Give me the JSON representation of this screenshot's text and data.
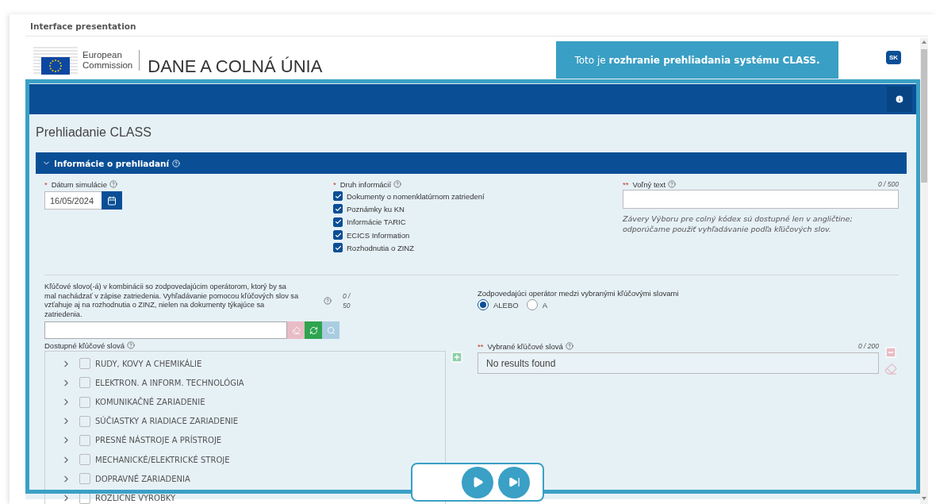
{
  "presentation": {
    "title": "Interface presentation"
  },
  "branding": {
    "org_line1": "European",
    "org_line2": "Commission",
    "site_title": "DANE A COLNÁ ÚNIA"
  },
  "notice": "Toto je **rozhranie prehliadania systému CLASS.**",
  "language": "SK",
  "page_title": "Prehliadanie CLASS",
  "section": {
    "title": "Informácie o prehliadaní",
    "expanded": true
  },
  "simulation_date": {
    "required_mark": "*",
    "label": "Dátum simulácie",
    "value": "16/05/2024"
  },
  "info_types": {
    "required_mark": "*",
    "label": "Druh informácií",
    "options": [
      {
        "label": "Dokumenty o nomenklatúrnom zatriedení",
        "checked": true
      },
      {
        "label": "Poznámky ku KN",
        "checked": true
      },
      {
        "label": "Informácie TARIC",
        "checked": true
      },
      {
        "label": "ECICS Information",
        "checked": true
      },
      {
        "label": "Rozhodnutia o ZINZ",
        "checked": true
      }
    ]
  },
  "free_text": {
    "required_mark": "**",
    "label": "Voľný text",
    "counter": "0 / 500",
    "note": "Závery Výboru pre colný kódex sú dostupné len v angličtine; odporúčame použiť vyhľadávanie podľa kľúčových slov."
  },
  "keyword": {
    "description": "Kľúčové slovo(-á) v kombinácii so zodpovedajúcim operátorom, ktorý by sa mal nachádzať v zápise zatriedenia. Vyhľadávanie pomocou kľúčových slov sa vzťahuje aj na rozhodnutia o ZINZ, nielen na dokumenty týkajúce sa zatriedenia.",
    "counter": "0 / 50"
  },
  "available": {
    "label": "Dostupné kľúčové slová",
    "items": [
      {
        "label": "RUDY, KOVY A CHEMIKÁLIE",
        "checked": false,
        "expanded": false
      },
      {
        "label": "ELEKTRON. A INFORM. TECHNOLÓGIA",
        "checked": false,
        "expanded": false
      },
      {
        "label": "KOMUNIKAČNÉ ZARIADENIE",
        "checked": false,
        "expanded": false
      },
      {
        "label": "SÚČIASTKY A RIADIACE ZARIADENIE",
        "checked": false,
        "expanded": false
      },
      {
        "label": "PRESNÉ NÁSTROJE A PRÍSTROJE",
        "checked": false,
        "expanded": false
      },
      {
        "label": "MECHANICKÉ/ELEKTRICKÉ STROJE",
        "checked": false,
        "expanded": false
      },
      {
        "label": "DOPRAVNÉ ZARIADENIA",
        "checked": false,
        "expanded": false
      },
      {
        "label": "ROZLICNE VYROBKY",
        "checked": false,
        "expanded": false
      }
    ]
  },
  "operator": {
    "label": "Zodpovedajúci operátor medzi vybranými kľúčovými slovami",
    "options": [
      {
        "label": "ALEBO",
        "selected": true
      },
      {
        "label": "A",
        "selected": false
      }
    ]
  },
  "selected_keywords": {
    "required_mark": "**",
    "label": "Vybrané kľúčové slová",
    "counter": "0 / 200",
    "empty_text": "No results found"
  }
}
